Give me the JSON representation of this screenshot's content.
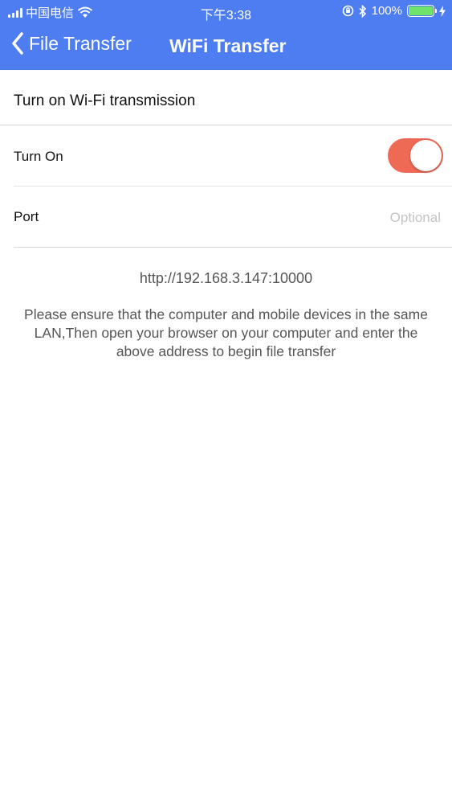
{
  "status_bar": {
    "carrier": "中国电信",
    "time": "下午3:38",
    "battery_percent": "100%",
    "battery_level": 1.0,
    "icons": [
      "signal-icon",
      "wifi-icon",
      "orientation-lock-icon",
      "bluetooth-icon",
      "battery-icon",
      "charging-icon"
    ]
  },
  "nav": {
    "back_label": "File Transfer",
    "title": "WiFi Transfer"
  },
  "section": {
    "title": "Turn on Wi-Fi transmission"
  },
  "settings": {
    "turn_on_label": "Turn On",
    "turn_on_state": true,
    "port_label": "Port",
    "port_value": "",
    "port_placeholder": "Optional"
  },
  "info": {
    "address": "http://192.168.3.147:10000",
    "instructions": "Please ensure that the computer and mobile devices in the same LAN,Then open your browser on your computer and enter the above address to begin file transfer"
  },
  "colors": {
    "header": "#4d7df0",
    "toggle_on": "#ef6a55",
    "battery": "#6fe36a"
  }
}
